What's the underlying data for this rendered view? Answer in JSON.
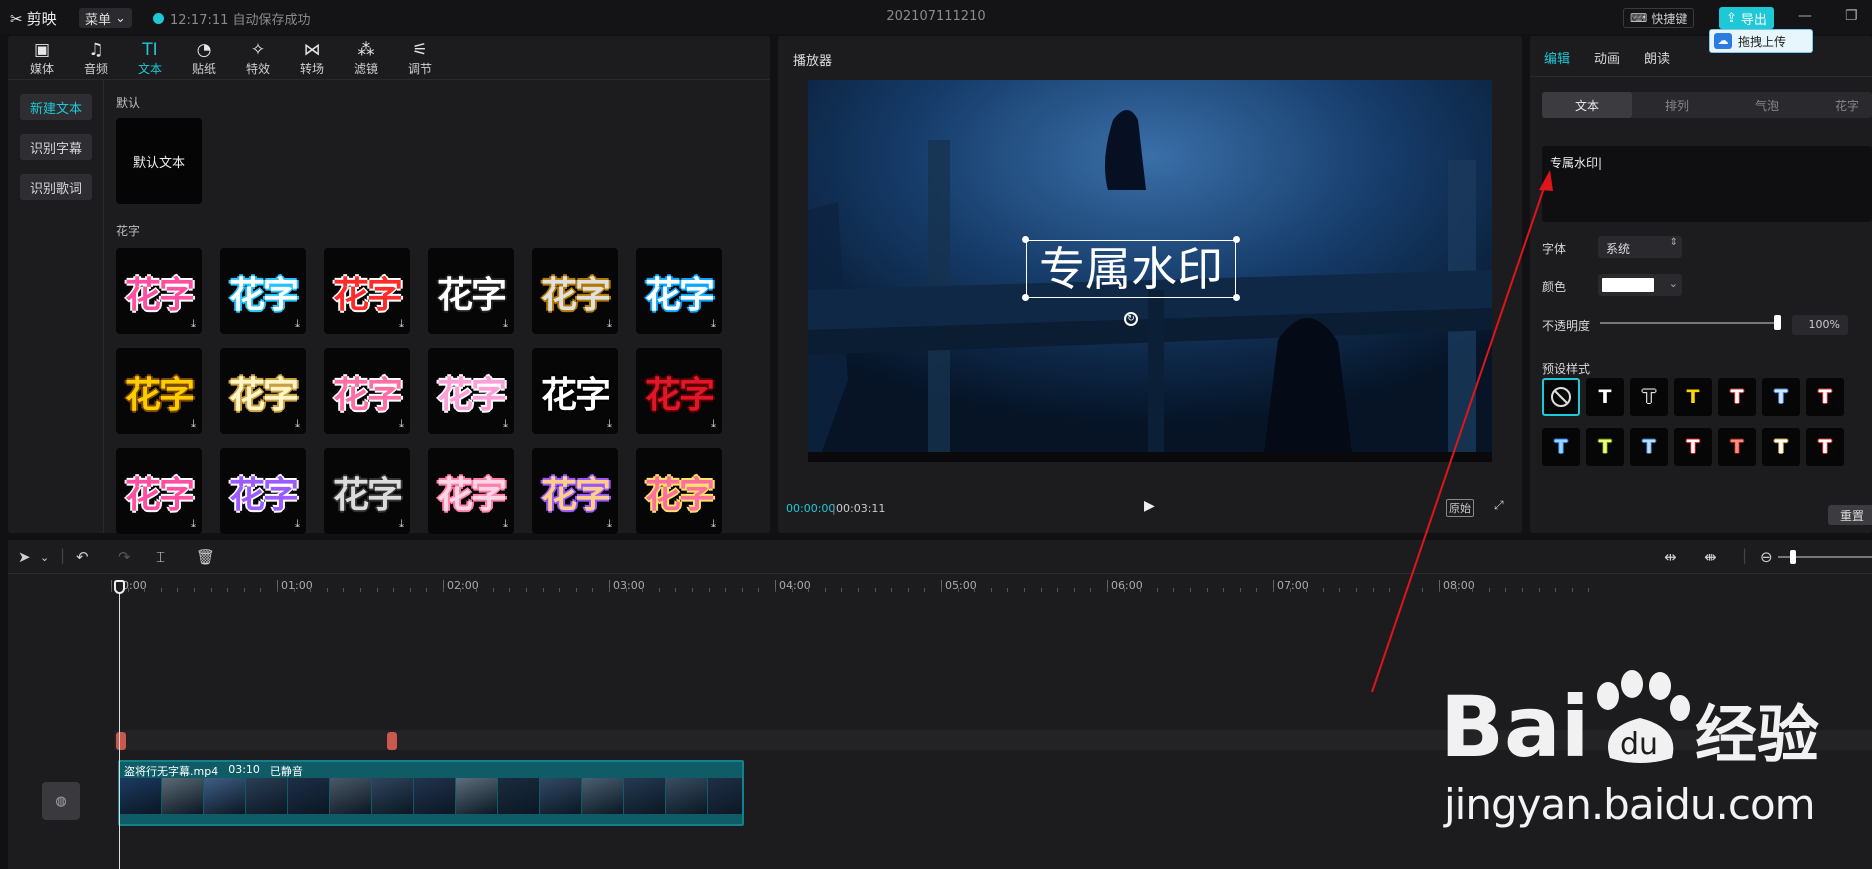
{
  "topbar": {
    "app_name": "剪映",
    "menu_label": "菜单",
    "save_status": "12:17:11 自动保存成功",
    "project_title": "202107111210",
    "shortcut_label": "快捷键",
    "export_label": "导出",
    "upload_tip": "拖拽上传"
  },
  "left_toolbar": [
    {
      "label": "媒体",
      "icon": "media-icon"
    },
    {
      "label": "音频",
      "icon": "audio-icon"
    },
    {
      "label": "文本",
      "icon": "text-icon",
      "active": true
    },
    {
      "label": "贴纸",
      "icon": "sticker-icon"
    },
    {
      "label": "特效",
      "icon": "effect-icon"
    },
    {
      "label": "转场",
      "icon": "transition-icon"
    },
    {
      "label": "滤镜",
      "icon": "filter-icon"
    },
    {
      "label": "调节",
      "icon": "adjust-icon"
    }
  ],
  "side_buttons": [
    "新建文本",
    "识别字幕",
    "识别歌词"
  ],
  "sections": {
    "default": "默认",
    "default_card": "默认文本",
    "fancy": "花字"
  },
  "fancy_text": "花字",
  "player": {
    "title": "播放器",
    "overlay_text": "专属水印",
    "time_current": "00:00:00",
    "time_total": "00:03:11",
    "original_label": "原始"
  },
  "right_panel": {
    "tabs": [
      "编辑",
      "动画",
      "朗读"
    ],
    "subtabs": [
      "文本",
      "排列",
      "气泡",
      "花字"
    ],
    "text_value": "专属水印",
    "font_label": "字体",
    "font_value": "系统",
    "color_label": "颜色",
    "color_value": "#ffffff",
    "opacity_label": "不透明度",
    "opacity_value": "100%",
    "presets_label": "预设样式",
    "reset_label": "重置"
  },
  "timeline": {
    "ruler": [
      "00:00",
      "01:00",
      "02:00",
      "03:00",
      "04:00",
      "05:00",
      "06:00",
      "07:00",
      "08:00"
    ],
    "clip_name": "盗将行无字幕.mp4",
    "clip_duration": "03:10",
    "clip_muted": "已静音"
  },
  "watermark": {
    "brand": "Bai  经验",
    "url": "jingyan.baidu.com"
  },
  "colors": {
    "accent": "#1ec8d6",
    "panel": "#1c1c1f",
    "annotation_arrow": "#e0151b"
  }
}
